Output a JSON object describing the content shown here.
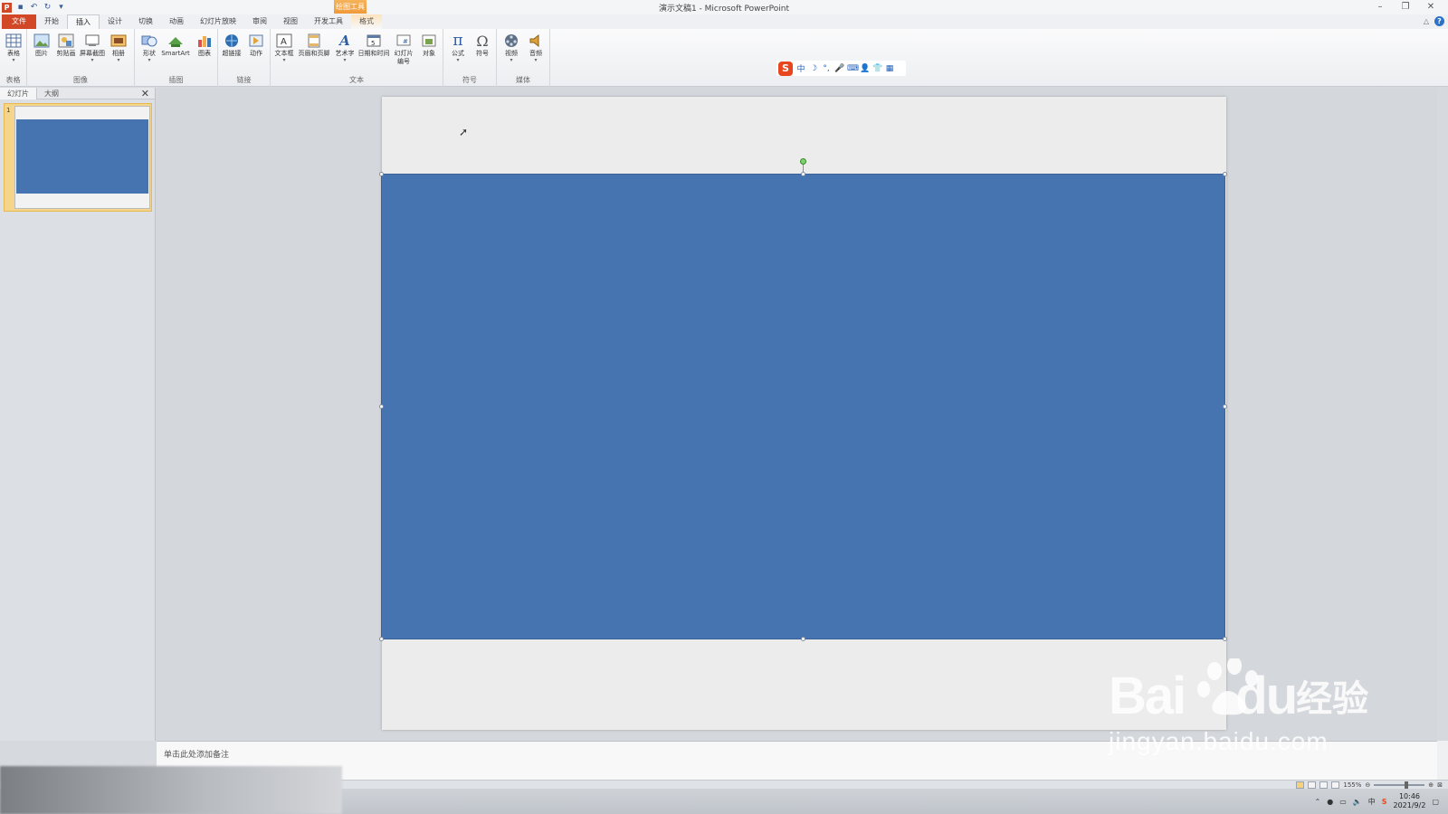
{
  "window": {
    "title": "演示文稿1 - Microsoft PowerPoint",
    "controls": [
      "–",
      "❐",
      "✕"
    ]
  },
  "context_header": "绘图工具",
  "tabs": [
    {
      "label": "文件",
      "kind": "file"
    },
    {
      "label": "开始",
      "kind": ""
    },
    {
      "label": "插入",
      "kind": "active"
    },
    {
      "label": "设计",
      "kind": ""
    },
    {
      "label": "切换",
      "kind": ""
    },
    {
      "label": "动画",
      "kind": ""
    },
    {
      "label": "幻灯片放映",
      "kind": ""
    },
    {
      "label": "审阅",
      "kind": ""
    },
    {
      "label": "视图",
      "kind": ""
    },
    {
      "label": "开发工具",
      "kind": ""
    },
    {
      "label": "格式",
      "kind": "context"
    }
  ],
  "ribbon": {
    "groups": {
      "tables": "表格",
      "images": "图像",
      "illustrations": "插图",
      "links": "链接",
      "text": "文本",
      "symbols": "符号",
      "media": "媒体"
    },
    "buttons": {
      "table": "表格",
      "picture": "图片",
      "clipart": "剪贴画",
      "screenshot": "屏幕截图",
      "album": "相册",
      "shapes": "形状",
      "smartart": "SmartArt",
      "chart": "图表",
      "hyperlink": "超链接",
      "action": "动作",
      "textbox": "文本框",
      "headerfooter": "页眉和页脚",
      "wordart": "艺术字",
      "datetime": "日期和时间",
      "slidenum_1": "幻灯片",
      "slidenum_2": "编号",
      "object": "对象",
      "equation": "公式",
      "symbol": "符号",
      "video": "视频",
      "audio": "音频"
    }
  },
  "ime": {
    "logo": "S",
    "items": [
      "中",
      "☽",
      "°,",
      "🎤",
      "⌨",
      "👤",
      "👕",
      "▦"
    ]
  },
  "left_pane": {
    "tabs": [
      "幻灯片",
      "大纲"
    ],
    "close": "✕",
    "slide_number": "1"
  },
  "notes": {
    "placeholder": "单击此处添加备注"
  },
  "status": {
    "zoom": "155%"
  },
  "taskbar": {
    "time": "10:46",
    "date": "2021/9/2"
  },
  "watermark": {
    "brand": "Bai",
    "brand2": "du",
    "cn": "经验",
    "url": "jingyan.baidu.com"
  },
  "colors": {
    "shape_fill": "#4674b0",
    "file_tab": "#d24726",
    "context": "#f09a3a"
  }
}
